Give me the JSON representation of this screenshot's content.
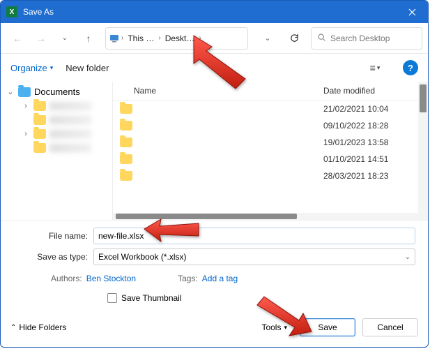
{
  "titlebar": {
    "title": "Save As"
  },
  "nav": {
    "crumb_root": "This …",
    "crumb_leaf": "Deskt…",
    "search_placeholder": "Search Desktop"
  },
  "toolbar": {
    "organize": "Organize",
    "newfolder": "New folder"
  },
  "tree": {
    "root": "Documents"
  },
  "filelist": {
    "header_name": "Name",
    "header_date": "Date modified",
    "rows": [
      {
        "date": "21/02/2021 10:04"
      },
      {
        "date": "09/10/2022 18:28"
      },
      {
        "date": "19/01/2023 13:58"
      },
      {
        "date": "01/10/2021 14:51"
      },
      {
        "date": "28/03/2021 18:23"
      }
    ]
  },
  "form": {
    "filename_label": "File name:",
    "filename_value": "new-file.xlsx",
    "saveas_label": "Save as type:",
    "saveas_value": "Excel Workbook (*.xlsx)",
    "authors_label": "Authors:",
    "authors_value": "Ben Stockton",
    "tags_label": "Tags:",
    "tags_value": "Add a tag",
    "thumb_label": "Save Thumbnail"
  },
  "footer": {
    "hide": "Hide Folders",
    "tools": "Tools",
    "save": "Save",
    "cancel": "Cancel"
  }
}
